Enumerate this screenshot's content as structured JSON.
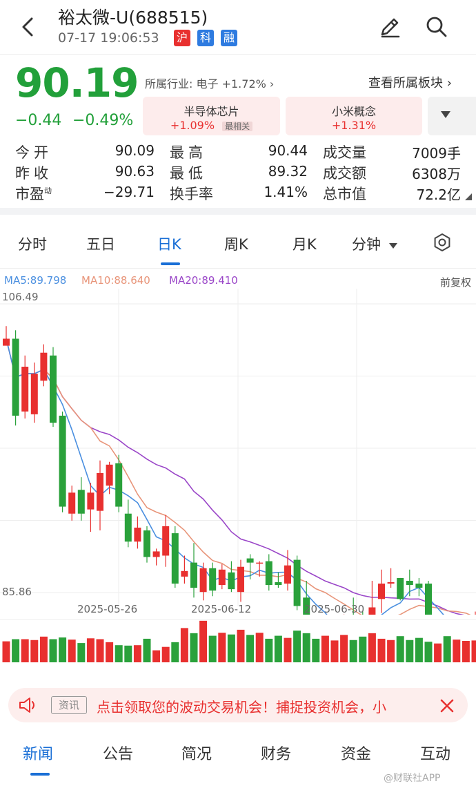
{
  "header": {
    "title": "裕太微-U(688515)",
    "datetime": "07-17 19:06:53",
    "tags": [
      {
        "label": "沪",
        "color": "#e8302f"
      },
      {
        "label": "科",
        "color": "#2e7be0"
      },
      {
        "label": "融",
        "color": "#2e7be0"
      }
    ]
  },
  "quote": {
    "price": "90.19",
    "change": "−0.44",
    "change_pct": "−0.49%",
    "industry_label": "所属行业:",
    "industry_value": "电子 +1.72%",
    "board_link": "查看所属板块",
    "boards": [
      {
        "name": "半导体芯片",
        "value": "+1.09%",
        "badge": "最相关"
      },
      {
        "name": "小米概念",
        "value": "+1.31%",
        "badge": ""
      }
    ]
  },
  "stats": [
    {
      "label": "今开",
      "value": "90.09",
      "color": "green"
    },
    {
      "label": "最高",
      "value": "90.44",
      "color": "green"
    },
    {
      "label": "成交量",
      "value": "7009手",
      "color": "black"
    },
    {
      "label": "昨收",
      "value": "90.63",
      "color": "black"
    },
    {
      "label": "最低",
      "value": "89.32",
      "color": "green"
    },
    {
      "label": "成交额",
      "value": "6308万",
      "color": "black"
    },
    {
      "label": "市盈",
      "label_sup": "动",
      "value": "−29.71",
      "color": "black"
    },
    {
      "label": "换手率",
      "value": "1.41%",
      "color": "black"
    },
    {
      "label": "总市值",
      "value": "72.2亿",
      "color": "black"
    }
  ],
  "tabs": [
    "分时",
    "五日",
    "日K",
    "周K",
    "月K",
    "分钟"
  ],
  "active_tab": "日K",
  "ma": {
    "ma5": "MA5:89.798",
    "ma10": "MA10:88.640",
    "ma20": "MA20:89.410",
    "colors": {
      "ma5": "#4a8fe0",
      "ma10": "#e8957a",
      "ma20": "#9a46c8"
    },
    "adjust": "前复权"
  },
  "chart_data": {
    "type": "candlestick",
    "y_max_label": "106.49",
    "y_min_label": "85.86",
    "ylim": [
      85.86,
      106.49
    ],
    "date_labels": [
      "2025-05-26",
      "2025-06-12",
      "2025-06-30"
    ],
    "candles": [
      [
        103.5,
        104.0,
        104.9,
        103.6
      ],
      [
        104.0,
        98.5,
        104.6,
        97.8
      ],
      [
        98.8,
        102.0,
        102.8,
        98.3
      ],
      [
        98.6,
        101.5,
        102.3,
        98.0
      ],
      [
        101.0,
        103.0,
        103.6,
        100.6
      ],
      [
        102.8,
        98.0,
        103.4,
        97.7
      ],
      [
        98.5,
        92.0,
        98.8,
        91.6
      ],
      [
        91.5,
        93.0,
        93.5,
        91.0
      ],
      [
        93.2,
        91.5,
        94.1,
        91.0
      ],
      [
        91.8,
        93.0,
        93.7,
        90.2
      ],
      [
        91.7,
        94.4,
        95.3,
        90.3
      ],
      [
        93.5,
        95.0,
        95.2,
        92.9
      ],
      [
        95.1,
        92.0,
        95.7,
        91.6
      ],
      [
        91.5,
        89.5,
        92.5,
        89.1
      ],
      [
        89.5,
        90.5,
        91.3,
        89.0
      ],
      [
        90.3,
        88.4,
        90.6,
        88.0
      ],
      [
        88.4,
        88.8,
        89.0,
        87.8
      ],
      [
        88.5,
        90.6,
        91.4,
        87.7
      ],
      [
        90.1,
        86.5,
        90.6,
        86.2
      ],
      [
        87.0,
        87.4,
        88.5,
        86.5
      ],
      [
        88.0,
        86.2,
        89.4,
        85.5
      ],
      [
        85.9,
        87.6,
        88.0,
        85.3
      ],
      [
        87.6,
        86.0,
        88.0,
        85.6
      ],
      [
        86.4,
        87.5,
        87.9,
        86.1
      ],
      [
        87.3,
        86.1,
        88.1,
        85.9
      ],
      [
        85.9,
        87.7,
        88.2,
        85.2
      ],
      [
        88.3,
        88.0,
        88.6,
        86.8
      ],
      [
        88.0,
        88.0,
        88.1,
        87.0
      ],
      [
        88.1,
        86.4,
        88.6,
        86.0
      ],
      [
        86.6,
        86.4,
        87.3,
        86.2
      ],
      [
        86.5,
        87.8,
        88.9,
        86.0
      ],
      [
        88.2,
        84.9,
        88.5,
        84.6
      ],
      [
        85.5,
        83.3,
        86.7,
        82.5
      ],
      [
        83.7,
        82.7,
        84.0,
        82.3
      ],
      [
        82.7,
        83.4,
        84.0,
        82.8
      ],
      [
        83.0,
        83.5,
        84.1,
        82.3
      ],
      [
        83.5,
        84.0,
        84.3,
        82.8
      ],
      [
        84.0,
        83.7,
        85.5,
        82.8
      ],
      [
        84.0,
        82.3,
        84.5,
        82.1
      ],
      [
        82.2,
        84.8,
        86.7,
        81.8
      ],
      [
        85.4,
        86.5,
        87.5,
        84.4
      ],
      [
        86.5,
        86.6,
        87.6,
        86.2
      ],
      [
        86.9,
        85.4,
        86.9,
        85.3
      ],
      [
        86.7,
        86.4,
        87.5,
        85.6
      ],
      [
        86.5,
        86.2,
        86.9,
        85.6
      ],
      [
        86.5,
        82.7,
        86.7,
        82.3
      ],
      [
        82.7,
        83.0,
        83.4,
        82.5
      ],
      [
        83.0,
        81.6,
        83.8,
        81.4
      ],
      [
        81.5,
        81.9,
        82.9,
        81.3
      ],
      [
        82.2,
        83.6,
        84.0,
        82.0
      ],
      [
        83.1,
        83.6,
        84.5,
        82.8
      ],
      [
        83.6,
        83.7,
        84.4,
        83.0
      ],
      [
        83.5,
        84.8,
        85.3,
        83.3
      ],
      [
        84.8,
        85.0,
        85.7,
        84.3
      ],
      [
        85.1,
        85.2,
        86.2,
        84.7
      ],
      [
        85.0,
        84.5,
        85.3,
        84.3
      ],
      [
        84.3,
        86.2,
        86.6,
        84.0
      ],
      [
        86.3,
        86.0,
        86.6,
        85.5
      ]
    ],
    "volumes": [
      0.49,
      0.54,
      0.54,
      0.52,
      0.6,
      0.54,
      0.58,
      0.53,
      0.45,
      0.56,
      0.54,
      0.47,
      0.4,
      0.39,
      0.4,
      0.55,
      0.28,
      0.36,
      0.47,
      0.8,
      0.68,
      0.97,
      0.62,
      0.69,
      0.65,
      0.76,
      0.64,
      0.69,
      0.55,
      0.62,
      0.57,
      0.74,
      0.68,
      0.55,
      0.62,
      0.51,
      0.64,
      0.52,
      0.6,
      0.68,
      0.55,
      0.52,
      0.61,
      0.52,
      0.57,
      0.48,
      0.44,
      0.61,
      0.53,
      0.5,
      0.51,
      0.46,
      0.61,
      0.47,
      0.4,
      0.4,
      0.47,
      0.43
    ]
  },
  "banner": {
    "tag": "资讯",
    "text": "点击领取您的波动交易机会！捕捉投资机会，小"
  },
  "bottom_tabs": [
    "新闻",
    "公告",
    "简况",
    "财务",
    "资金",
    "互动"
  ],
  "active_bottom_tab": "新闻",
  "watermark": "@财联社APP"
}
